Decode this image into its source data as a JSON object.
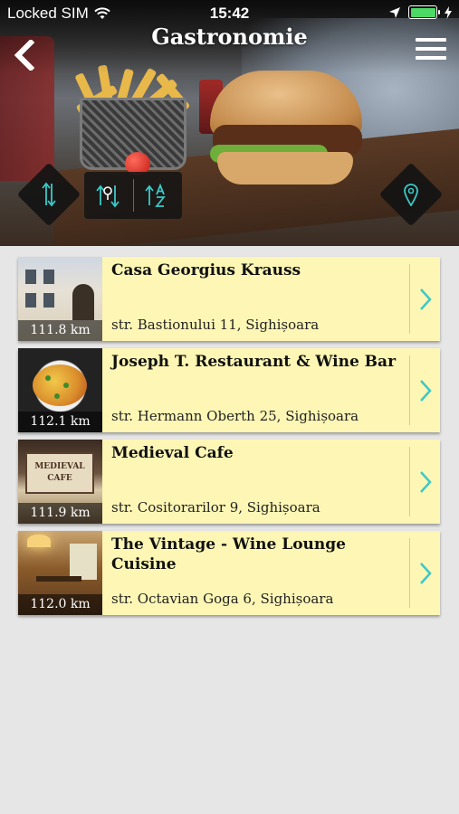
{
  "status_bar": {
    "carrier": "Locked SIM",
    "time": "15:42"
  },
  "nav": {
    "title": "Gastronomie"
  },
  "colors": {
    "card_bg": "#fdf6b5",
    "accent": "#3cc8c8",
    "battery": "#4cd964"
  },
  "actions": [
    {
      "name": "sort-direction",
      "icon": "up-down-arrows-icon"
    },
    {
      "name": "sort-by-distance",
      "icon": "distance-sort-icon"
    },
    {
      "name": "sort-alphabetical",
      "icon": "az-sort-icon"
    },
    {
      "name": "map-view",
      "icon": "map-pin-icon"
    }
  ],
  "places": [
    {
      "name": "Casa Georgius Krauss",
      "address": "str. Bastionului 11, Sighișoara",
      "distance": "111.8 km"
    },
    {
      "name": "Joseph T. Restaurant & Wine Bar",
      "address": "str. Hermann Oberth 25, Sighișoara",
      "distance": "112.1 km"
    },
    {
      "name": "Medieval Cafe",
      "address": "str. Cositorarilor 9, Sighișoara",
      "distance": "111.9 km",
      "sign_lines": [
        "MEDIEVAL",
        "CAFE"
      ]
    },
    {
      "name": "The Vintage - Wine Lounge Cuisine",
      "address": "str. Octavian Goga 6, Sighișoara",
      "distance": "112.0 km"
    }
  ]
}
